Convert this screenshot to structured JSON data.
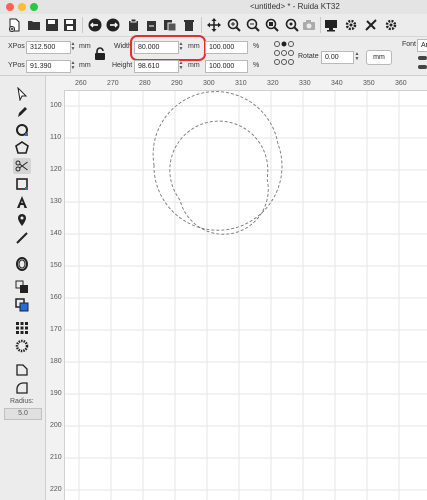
{
  "window": {
    "title": "<untitled> * - Ruida KT32",
    "traffic_lights": [
      "#fe5f57",
      "#febc2e",
      "#28c840"
    ]
  },
  "toolbar": {
    "icons": [
      "new-file-icon",
      "open-folder-icon",
      "save-icon",
      "save-as-icon",
      "undo-icon",
      "redo-icon",
      "copy-icon",
      "cut-icon",
      "paste-icon",
      "delete-icon",
      "move-icon",
      "zoom-in-icon",
      "zoom-out-icon",
      "zoom-fit-icon",
      "zoom-page-icon",
      "camera-icon",
      "monitor-icon",
      "settings-icon",
      "tools-icon",
      "laser-settings-icon"
    ]
  },
  "props": {
    "xpos_label": "XPos",
    "xpos_value": "312.500",
    "xpos_unit": "mm",
    "ypos_label": "YPos",
    "ypos_value": "91.390",
    "ypos_unit": "mm",
    "width_label": "Width",
    "width_value": "80.000",
    "width_unit": "mm",
    "height_label": "Height",
    "height_value": "98.610",
    "height_unit": "mm",
    "width_pct": "100.000",
    "height_pct": "100.000",
    "pct_unit": "%",
    "rotate_label": "Rotate",
    "rotate_value": "0.00",
    "rotate_unit": "mm",
    "font_label": "Font",
    "font_value": "Ar"
  },
  "left_tools": {
    "radius_label": "Radius:",
    "radius_value": "5.0"
  },
  "ruler": {
    "x_ticks": [
      "260",
      "270",
      "280",
      "290",
      "300",
      "310",
      "320",
      "330",
      "340",
      "350",
      "360"
    ],
    "y_ticks": [
      "100",
      "110",
      "120",
      "130",
      "140",
      "150",
      "160",
      "170",
      "180",
      "190",
      "200",
      "210",
      "220"
    ]
  },
  "colors": {
    "highlight": "#e03030",
    "accent": "#1e6fd9"
  }
}
